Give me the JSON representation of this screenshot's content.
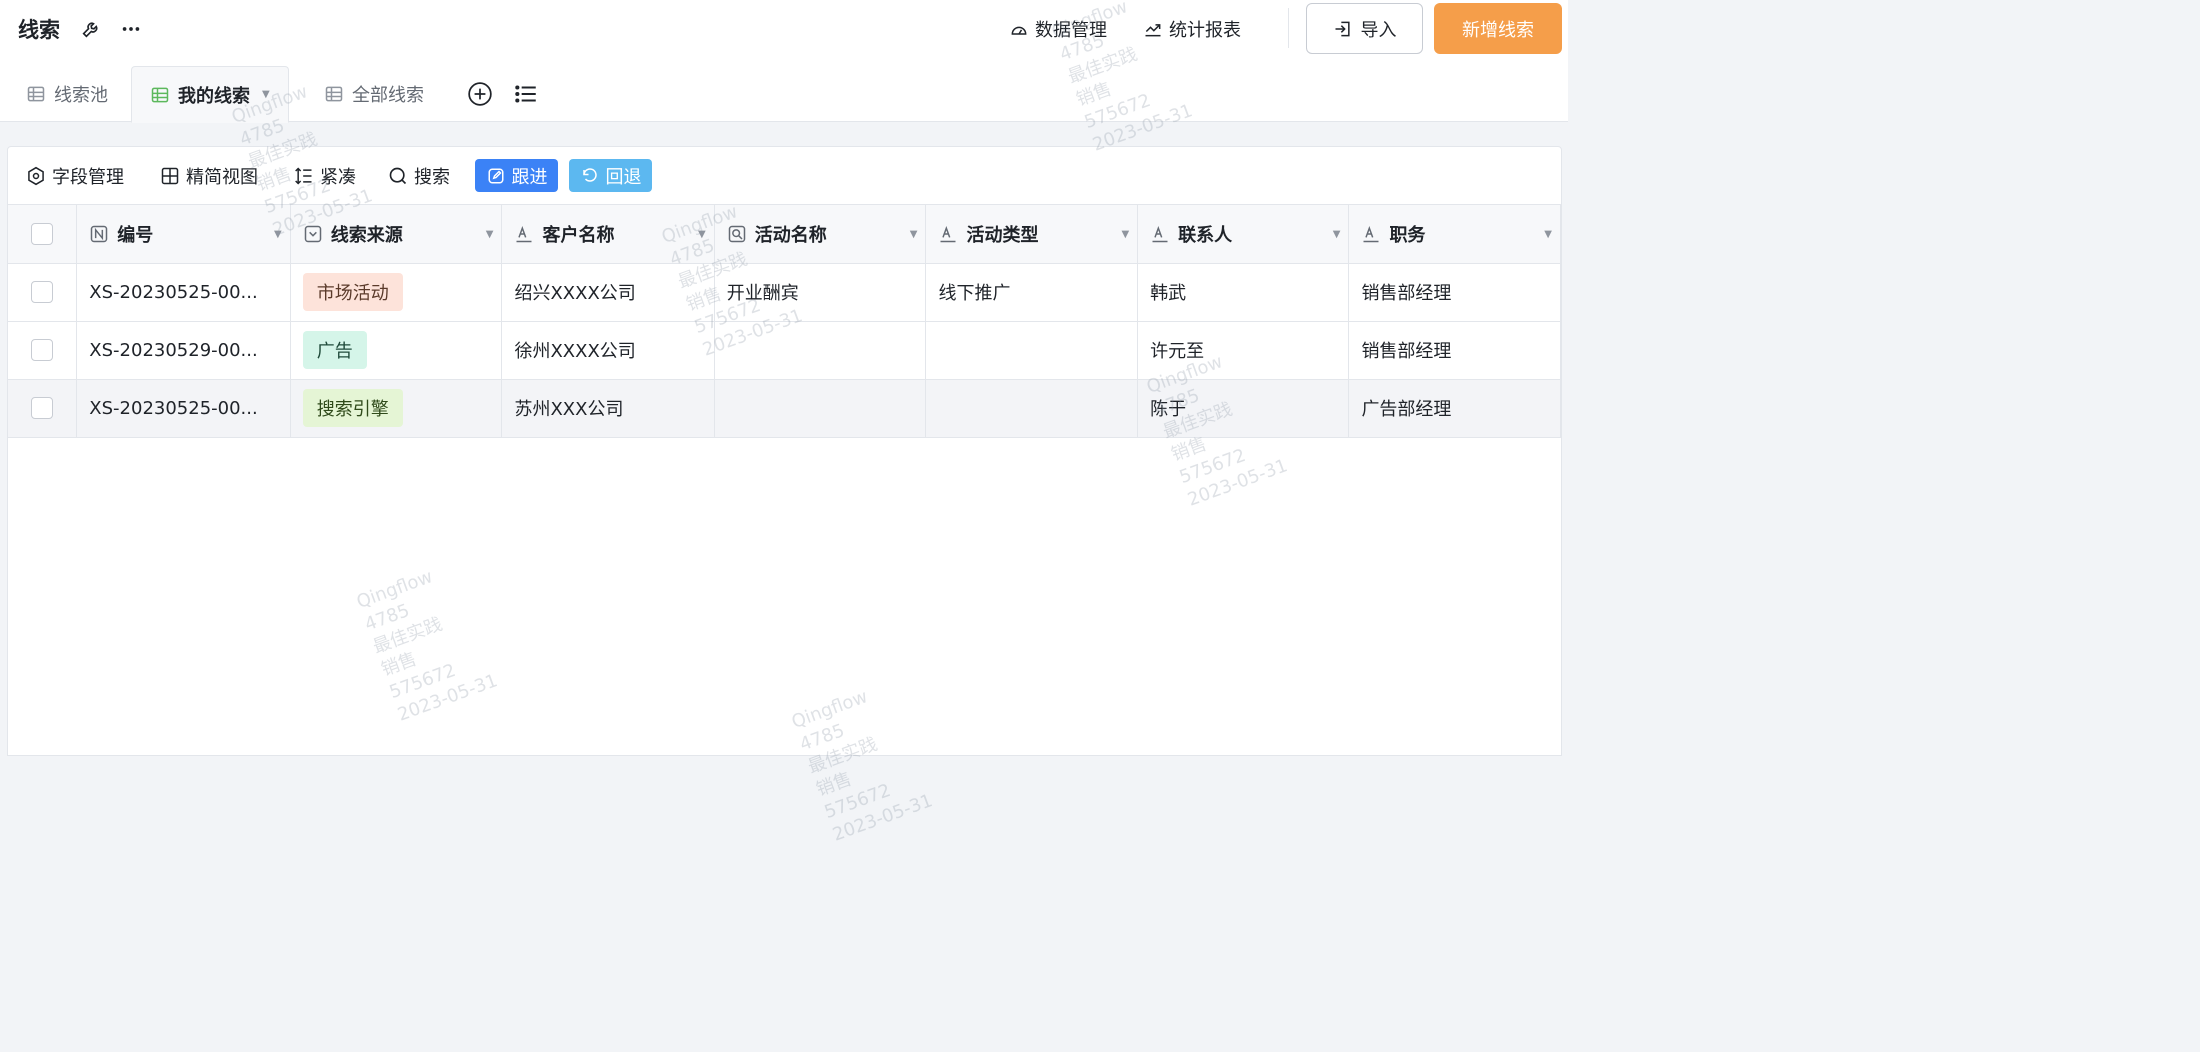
{
  "header": {
    "title": "线索",
    "data_manage_label": "数据管理",
    "stats_report_label": "统计报表",
    "import_label": "导入",
    "new_label": "新增线索"
  },
  "tabs": [
    {
      "label": "线索池"
    },
    {
      "label": "我的线索"
    },
    {
      "label": "全部线索"
    }
  ],
  "toolbar": {
    "field_manage": "字段管理",
    "simple_view": "精简视图",
    "compact": "紧凑",
    "search": "搜索",
    "follow": "跟进",
    "rollback": "回退"
  },
  "table": {
    "columns": [
      "编号",
      "线索来源",
      "客户名称",
      "活动名称",
      "活动类型",
      "联系人",
      "职务"
    ],
    "rows": [
      {
        "id": "XS-20230525-00...",
        "source": "市场活动",
        "customer": "绍兴XXXX公司",
        "activity": "开业酬宾",
        "activity_type": "线下推广",
        "contact": "韩武",
        "position": "销售部经理"
      },
      {
        "id": "XS-20230529-00...",
        "source": "广告",
        "customer": "徐州XXXX公司",
        "activity": "",
        "activity_type": "",
        "contact": "许元至",
        "position": "销售部经理"
      },
      {
        "id": "XS-20230525-00...",
        "source": "搜索引擎",
        "customer": "苏州XXX公司",
        "activity": "",
        "activity_type": "",
        "contact": "陈于",
        "position": "广告部经理"
      }
    ]
  },
  "watermark": {
    "lines": [
      "Qingflow",
      "4785",
      "最佳实践",
      "销售",
      "575672",
      "2023-05-31"
    ]
  },
  "colors": {
    "primary_orange": "#f59e4a",
    "follow_blue": "#3b82f6",
    "rollback_blue": "#5cb8f0",
    "tab_active_green": "#5cb85c"
  }
}
